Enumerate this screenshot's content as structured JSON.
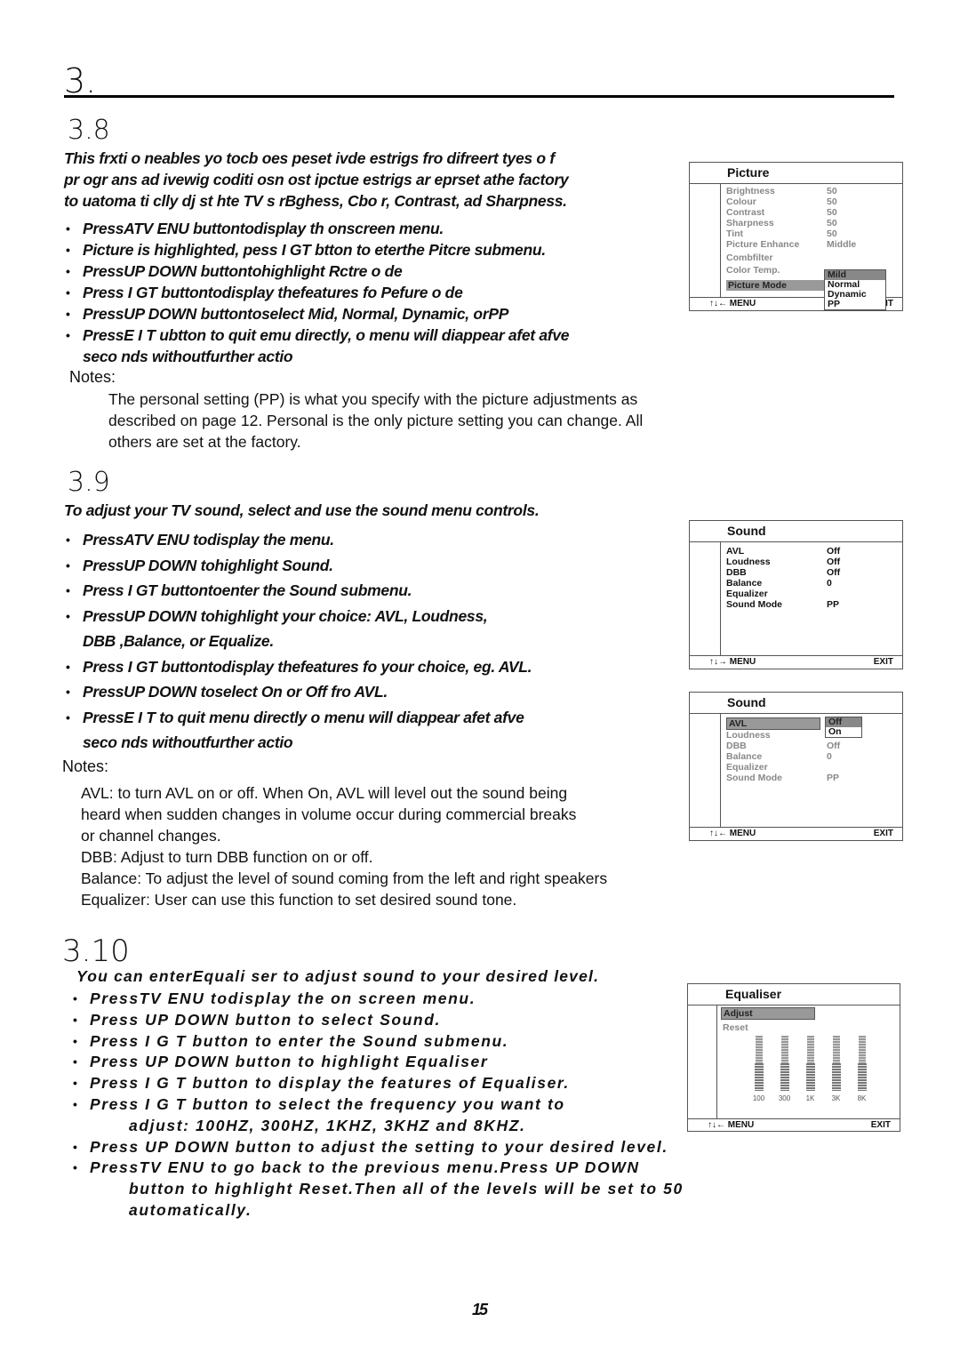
{
  "chapter": {
    "number": "3."
  },
  "section_3_8": {
    "number": "3.8",
    "intro": [
      "This  frxti o neables  yo  tocb oes  peset  ivde  estrigs   fro difreert  tyes  o f",
      "pr ogr ans   ad  ivewig  coditi osn    ost  ipctue  estrigs   ar eprset  athe  factory",
      "to  uatoma ti clly  dj st hte  TV  s rBghess,  Cbo r,  Contrast,  ad  Sharpness."
    ],
    "bullets": [
      {
        "text": "PressATV    ENU  buttontodisplay    th onscreen menu."
      },
      {
        "text": "Picture is highlighted,   pess   I GT   btton to eterthe   Pitcre  submenu."
      },
      {
        "text": "PressUP DOWN   buttontohighlight  Rctre  o de"
      },
      {
        "text": "Press   I GT   buttontodisplay   thefeatures  fo  Pefure  o de"
      },
      {
        "text": "PressUP DOWN   buttontoselect   Mid, Normal,  Dynamic,   orPP"
      },
      {
        "text": "PressE  I T ubtton to quit  emu   directly,   o menu will diappear  afet   afve",
        "cont": "seco nds   withoutfurther   actio"
      }
    ],
    "notes_label": "Notes:",
    "notes": [
      "The personal setting (PP) is what you specify with the picture adjustments as",
      "described on page 12. Personal is the only picture setting you can change. All",
      "others are set at the factory."
    ]
  },
  "picture_menu": {
    "title": "Picture",
    "rows": [
      {
        "label": "Brightness",
        "value": "50"
      },
      {
        "label": "Colour",
        "value": "50"
      },
      {
        "label": "Contrast",
        "value": "50"
      },
      {
        "label": "Sharpness",
        "value": "50"
      },
      {
        "label": "Tint",
        "value": "50"
      },
      {
        "label": "Picture Enhance",
        "value": "Middle"
      },
      {
        "label": "Combfilter",
        "value": ""
      },
      {
        "label": "Color Temp.",
        "value": ""
      },
      {
        "label": "Picture Mode",
        "value": ""
      }
    ],
    "options": [
      "Mild",
      "Normal",
      "Dynamic",
      "PP"
    ],
    "selected_option": "Mild",
    "footer_nav": "↑↓← MENU",
    "footer_exit": "EXIT"
  },
  "section_3_9": {
    "number": "3.9",
    "intro": "To  adjust  your TV  sound,  select  and use  the sound   menu controls.",
    "bullets": [
      {
        "text": "PressATV    ENU  todisplay   the menu."
      },
      {
        "text": "PressUP DOWN   tohighlight  Sound."
      },
      {
        "text": "Press   I GT   buttontoenter the  Sound  submenu."
      },
      {
        "text": "PressUP DOWN   tohighlight  your choice:  AVL,   Loudness,",
        "cont": "DBB ,Balance, or  Equalize."
      },
      {
        "text": "Press   I GT   buttontodisplay   thefeatures  fo  your choice,  eg.  AVL."
      },
      {
        "text": "PressUP DOWN   toselect  On or Off fro AVL."
      },
      {
        "text": "PressE  I T to quit menu directly   o menu will diappear  afet   afve",
        "cont": "seco nds   withoutfurther   actio"
      }
    ],
    "notes_label": "Notes:",
    "notes": [
      "AVL: to turn AVL on or off. When On, AVL will level out the sound being",
      "heard when sudden changes in volume occur during commercial breaks",
      "or channel changes.",
      "DBB: Adjust to turn DBB function on or off.",
      "Balance: To adjust the level of sound coming from the left and right speakers",
      "Equalizer: User can use this function to set desired sound tone."
    ]
  },
  "sound_menu_1": {
    "title": "Sound",
    "rows": [
      {
        "label": "AVL",
        "value": "Off"
      },
      {
        "label": "Loudness",
        "value": "Off"
      },
      {
        "label": "DBB",
        "value": "Off"
      },
      {
        "label": "Balance",
        "value": "0"
      },
      {
        "label": "Equalizer",
        "value": ""
      },
      {
        "label": "Sound Mode",
        "value": "PP"
      }
    ],
    "footer_nav": "↑↓→ MENU",
    "footer_exit": "EXIT"
  },
  "sound_menu_2": {
    "title": "Sound",
    "rows": [
      {
        "label": "AVL",
        "value": ""
      },
      {
        "label": "Loudness",
        "value": ""
      },
      {
        "label": "DBB",
        "value": "Off"
      },
      {
        "label": "Balance",
        "value": "0"
      },
      {
        "label": "Equalizer",
        "value": ""
      },
      {
        "label": "Sound Mode",
        "value": "PP"
      }
    ],
    "options": [
      "Off",
      "On"
    ],
    "selected_option": "Off",
    "footer_nav": "↑↓← MENU",
    "footer_exit": "EXIT"
  },
  "section_3_10": {
    "number": "3.10",
    "intro": "You  can enterEquali ser   to   adjust sound  to your   desired level.",
    "bullets": [
      {
        "text": "PressTV    ENU  todisplay  the on screen menu."
      },
      {
        "text": "Press  UP DOWN  button to   select  Sound."
      },
      {
        "text": "Press    I G T button to enter   the  Sound submenu."
      },
      {
        "text": "Press  UP DOWN  button to   highlight  Equaliser"
      },
      {
        "text": "Press    I G T button to display   the features  of Equaliser."
      },
      {
        "text": "Press    I G T button to select  the  frequency you  want to",
        "cont": "adjust:   100HZ, 300HZ,  1KHZ,   3KHZ   and   8KHZ."
      },
      {
        "text": "Press  UP DOWN  button to   adjust the setting  to your desired level."
      },
      {
        "text": "PressTV    ENU  to go   back to   the previous   menu.Press  UP DOWN",
        "cont": "button to highlight    Reset.Then all of   the levels will be  set to 50",
        "cont2": "automatically."
      }
    ]
  },
  "equaliser_menu": {
    "title": "Equaliser",
    "items": [
      "Adjust",
      "Reset"
    ],
    "selected_item": "Adjust",
    "bands": [
      {
        "label": "100",
        "level": 0.5
      },
      {
        "label": "300",
        "level": 0.5
      },
      {
        "label": "1K",
        "level": 0.5
      },
      {
        "label": "3K",
        "level": 0.5
      },
      {
        "label": "8K",
        "level": 0.5
      }
    ],
    "footer_nav": "↑↓← MENU",
    "footer_exit": "EXIT"
  },
  "page_number": "15"
}
